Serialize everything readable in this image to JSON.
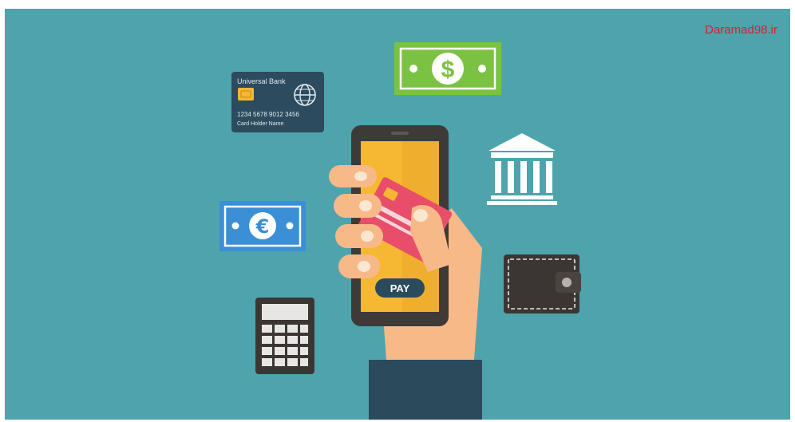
{
  "watermark": "Daramad98.ir",
  "bank_card": {
    "bank_name": "Universal Bank",
    "card_number": "1234 5678 9012 3456",
    "holder": "Card Holder Name"
  },
  "phone": {
    "pay_label": "PAY"
  },
  "colors": {
    "background": "#4fa3ad",
    "dollar_bill": "#7cc242",
    "euro_bill": "#3a8fd6",
    "bank_card": "#2c4b5f",
    "phone_screen": "#f6b733",
    "pay_card": "#e84e6a",
    "wallet": "#3b3634",
    "sleeve": "#2b4b5d",
    "skin": "#f8b989",
    "watermark": "#d3232b"
  },
  "icons": [
    "credit-card-icon",
    "dollar-bill-icon",
    "euro-bill-icon",
    "bank-building-icon",
    "wallet-icon",
    "calculator-icon",
    "smartphone-icon",
    "hand-icon"
  ]
}
